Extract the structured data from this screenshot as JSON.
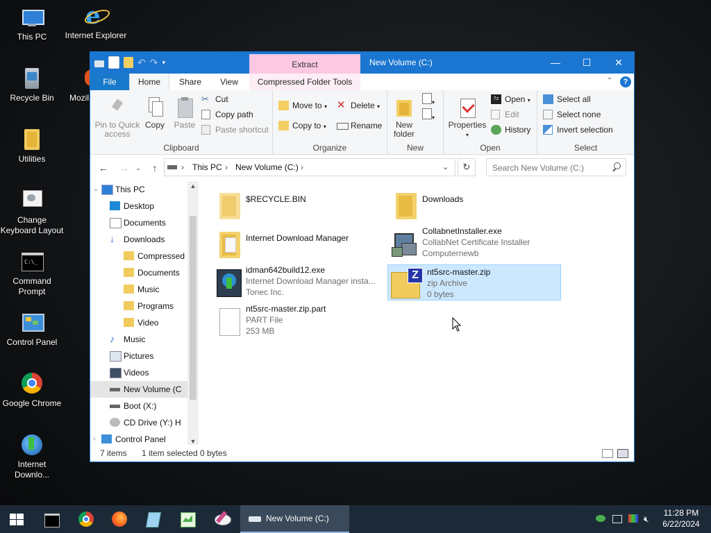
{
  "desktop": {
    "icons": [
      {
        "label": "This PC",
        "icon": "this-pc-icon"
      },
      {
        "label": "Internet Explorer",
        "icon": "internet-explorer-icon"
      },
      {
        "label": "Recycle Bin",
        "icon": "recycle-bin-icon"
      },
      {
        "label": "Mozil",
        "icon": "firefox-icon"
      },
      {
        "label": "Utilities",
        "icon": "folder-icon"
      },
      {
        "label": "Change Keyboard Layout",
        "icon": "keyboard-icon"
      },
      {
        "label": "Command Prompt",
        "icon": "cmd-icon"
      },
      {
        "label": "Control Panel",
        "icon": "control-panel-icon"
      },
      {
        "label": "Google Chrome",
        "icon": "chrome-icon"
      },
      {
        "label": "Internet Downlo...",
        "icon": "idm-icon"
      }
    ]
  },
  "window": {
    "title": "New Volume (C:)",
    "context_tab": "Extract",
    "controls": {
      "minimize": "—",
      "maximize": "☐",
      "close": "✕"
    },
    "tabs": {
      "file": "File",
      "home": "Home",
      "share": "Share",
      "view": "View",
      "compressed": "Compressed Folder Tools"
    },
    "help": "?"
  },
  "ribbon": {
    "clipboard": {
      "label": "Clipboard",
      "pin": "Pin to Quick access",
      "copy": "Copy",
      "paste": "Paste",
      "cut": "Cut",
      "copy_path": "Copy path",
      "paste_shortcut": "Paste shortcut"
    },
    "organize": {
      "label": "Organize",
      "move_to": "Move to",
      "copy_to": "Copy to",
      "delete": "Delete",
      "rename": "Rename"
    },
    "new": {
      "label": "New",
      "new_folder": "New folder"
    },
    "open": {
      "label": "Open",
      "properties": "Properties",
      "open": "Open",
      "edit": "Edit",
      "history": "History"
    },
    "select": {
      "label": "Select",
      "select_all": "Select all",
      "select_none": "Select none",
      "invert": "Invert selection"
    }
  },
  "address": {
    "segments": [
      "This PC",
      "New Volume (C:)"
    ],
    "search_placeholder": "Search New Volume (C:)"
  },
  "nav": {
    "items": [
      {
        "label": "This PC",
        "icon": "this-pc-icon",
        "indent": 0
      },
      {
        "label": "Desktop",
        "icon": "desktop-icon",
        "indent": 1
      },
      {
        "label": "Documents",
        "icon": "documents-icon",
        "indent": 1
      },
      {
        "label": "Downloads",
        "icon": "downloads-icon",
        "indent": 1
      },
      {
        "label": "Compressed",
        "icon": "folder-icon",
        "indent": 2
      },
      {
        "label": "Documents",
        "icon": "folder-icon",
        "indent": 2
      },
      {
        "label": "Music",
        "icon": "folder-icon",
        "indent": 2
      },
      {
        "label": "Programs",
        "icon": "folder-icon",
        "indent": 2
      },
      {
        "label": "Video",
        "icon": "folder-icon",
        "indent": 2
      },
      {
        "label": "Music",
        "icon": "music-icon",
        "indent": 1
      },
      {
        "label": "Pictures",
        "icon": "pictures-icon",
        "indent": 1
      },
      {
        "label": "Videos",
        "icon": "videos-icon",
        "indent": 1
      },
      {
        "label": "New Volume (C",
        "icon": "drive-icon",
        "indent": 1
      },
      {
        "label": "Boot (X:)",
        "icon": "drive-icon",
        "indent": 1
      },
      {
        "label": "CD Drive (Y:) H",
        "icon": "cd-drive-icon",
        "indent": 1
      },
      {
        "label": "Control Panel",
        "icon": "control-panel-icon",
        "indent": 0
      }
    ],
    "selected_index": 12
  },
  "files": [
    {
      "name": "$RECYCLE.BIN",
      "line2": "",
      "line3": "",
      "icon": "folder-icon"
    },
    {
      "name": "Downloads",
      "line2": "",
      "line3": "",
      "icon": "folder-icon"
    },
    {
      "name": "Internet Download Manager",
      "line2": "",
      "line3": "",
      "icon": "folder-icon"
    },
    {
      "name": "CollabnetInstaller.exe",
      "line2": "CollabNet Certificate Installer",
      "line3": "Computernewb",
      "icon": "installer-icon"
    },
    {
      "name": "idman642build12.exe",
      "line2": "Internet Download Manager insta...",
      "line3": "Tonec Inc.",
      "icon": "idm-installer-icon"
    },
    {
      "name": "nt5src-master.zip",
      "line2": "zip Archive",
      "line3": "0 bytes",
      "icon": "zip-icon"
    },
    {
      "name": "nt5src-master.zip.part",
      "line2": "PART File",
      "line3": "253 MB",
      "icon": "file-icon"
    }
  ],
  "status": {
    "count": "7 items",
    "selected": "1 item selected",
    "size": "0 bytes"
  },
  "taskbar": {
    "active_task": "New Volume (C:)",
    "time": "11:28 PM",
    "date": "6/22/2024"
  }
}
